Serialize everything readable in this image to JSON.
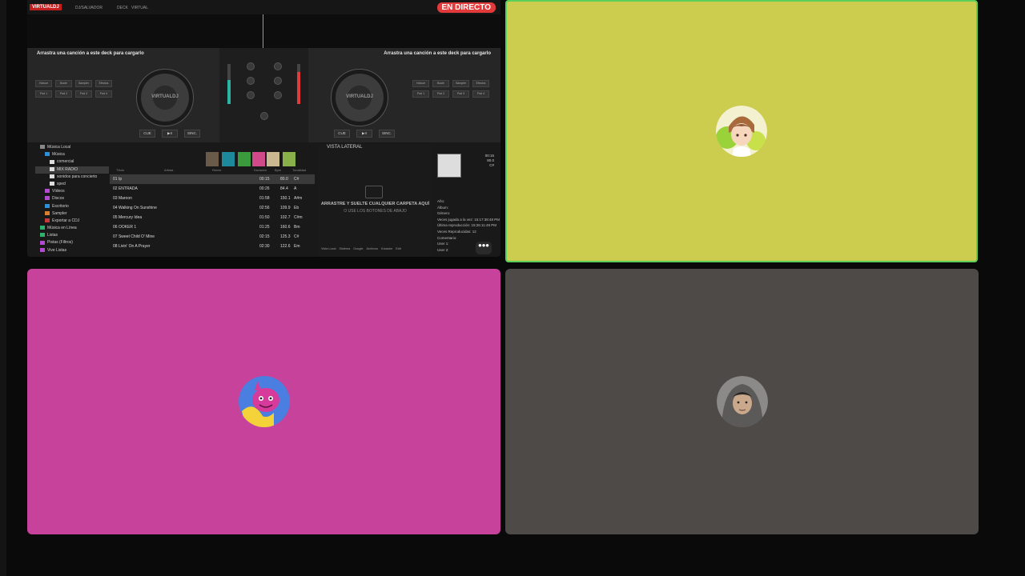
{
  "call": {
    "share_screen": {
      "app": {
        "logo": "VIRTUALDJ",
        "user": "DJ/SALVADOR",
        "mode_label": "DECK",
        "mode_value": "VIRTUAL",
        "live_badge": "EN DIRECTO",
        "deck_left_msg": "Arrastra una canción a este deck para cargarlo",
        "deck_right_msg": "Arrastra una canción a este deck para cargarlo",
        "turntable_label": "VIRTUALDJ",
        "pads": [
          "Hotcue",
          "Bucle",
          "Sampler",
          "Efectos",
          "Pad 1",
          "Pad 2",
          "Pad 3",
          "Pad 4"
        ],
        "transport": [
          "CUE",
          "▶II",
          "SINC."
        ],
        "tree": [
          {
            "label": "Música Local",
            "icon_color": "#888888"
          },
          {
            "label": "Música",
            "icon_color": "#2f8fd8"
          },
          {
            "label": "comercial",
            "icon_color": "#dddddd"
          },
          {
            "label": "MIX RADIO",
            "icon_color": "#dddddd"
          },
          {
            "label": "sonidos para concierto",
            "icon_color": "#dddddd"
          },
          {
            "label": "sped",
            "icon_color": "#dddddd"
          },
          {
            "label": "Vídeos",
            "icon_color": "#b34bd1"
          },
          {
            "label": "Discos",
            "icon_color": "#b34bd1"
          },
          {
            "label": "Escritorio",
            "icon_color": "#2f8fd8"
          },
          {
            "label": "Sampler",
            "icon_color": "#d8802f"
          },
          {
            "label": "Exportar a CDJ",
            "icon_color": "#c43a3a"
          },
          {
            "label": "Música en Línea",
            "icon_color": "#2fb06d"
          },
          {
            "label": "Listas",
            "icon_color": "#2fb06d"
          },
          {
            "label": "Pistas (Filtros)",
            "icon_color": "#b34bd1"
          },
          {
            "label": "Vive Listas",
            "icon_color": "#b34bd1"
          }
        ],
        "track_header": {
          "title": "Título",
          "artist": "Artista",
          "remix": "Remix",
          "duration": "Duración",
          "bpm": "Bpm",
          "key": "Tonalidad"
        },
        "tracks": [
          {
            "title": "01 Ip",
            "duration": "00:15",
            "bpm": "80.0",
            "key": "C#"
          },
          {
            "title": "02 ENTRADA",
            "duration": "00:26",
            "bpm": "84.4",
            "key": "A"
          },
          {
            "title": "03 Maroon",
            "duration": "01:58",
            "bpm": "150.1",
            "key": "A#m"
          },
          {
            "title": "04 Walking On Sunshine",
            "duration": "02:56",
            "bpm": "109.9",
            "key": "Eb"
          },
          {
            "title": "05 Mercury Idea",
            "duration": "01:50",
            "bpm": "102.7",
            "key": "C#m"
          },
          {
            "title": "06 OOKER 1",
            "duration": "01:25",
            "bpm": "160.6",
            "key": "Bm"
          },
          {
            "title": "07 Sweet Child O' Mine",
            "duration": "02:15",
            "bpm": "125.3",
            "key": "C#"
          },
          {
            "title": "08 Livin' On A Prayer",
            "duration": "02:30",
            "bpm": "122.6",
            "key": "Em"
          }
        ],
        "side_title": "VISTA LATERAL",
        "side_msg": "ARRASTRE Y SUELTE CUALQUIER CARPETA AQUÍ",
        "side_msg2": "O USE LOS BOTONES DE ABAJO",
        "side_tools": [
          "Vista Local",
          "Sistema",
          "Google",
          "Archivos",
          "Karaoke",
          "Edit"
        ],
        "info_meta": [
          "00:15",
          "80.0",
          "C#"
        ],
        "info_lines": [
          "Año:",
          "Álbum:",
          "Género:",
          "Veces jugada a la vez: 15:17:38:48 PM",
          "Última reproducción: 15:26:11:49 PM",
          "Veces Reproducidas: 12",
          "Comentario:",
          "User 1:",
          "User 2:"
        ]
      },
      "more_button": "•••"
    },
    "tiles": {
      "yellow_bg": "#cccc4f",
      "pink_bg": "#c7429b",
      "gray_bg": "#4d4a47",
      "active_border": "#5ad05a"
    }
  }
}
